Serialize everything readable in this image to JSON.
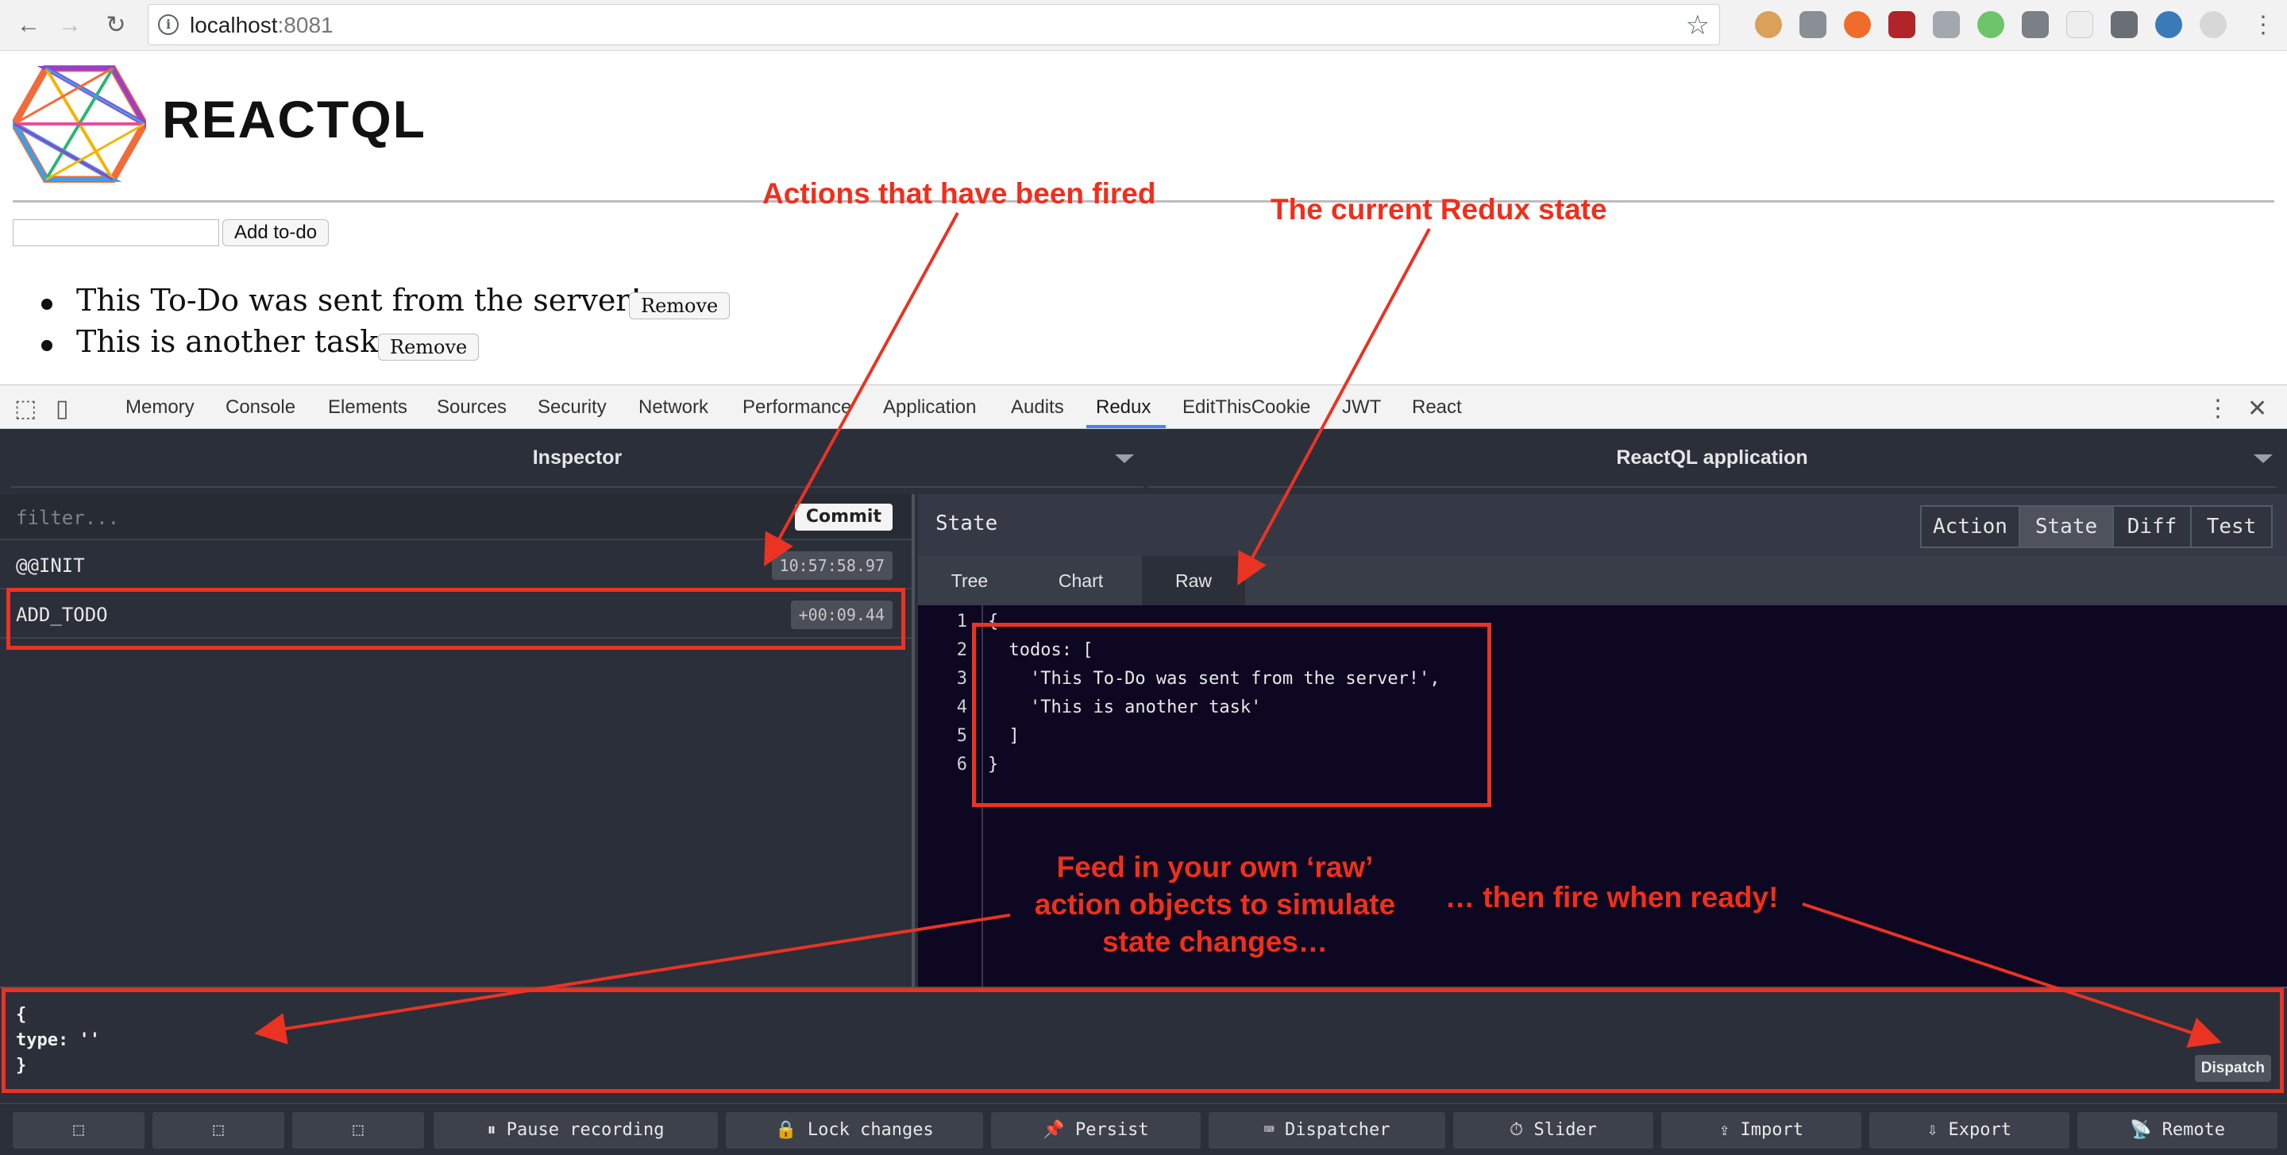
{
  "browser": {
    "url_host": "localhost",
    "url_port": ":8081"
  },
  "page": {
    "brand": "REACTQL",
    "add_button": "Add to-do",
    "todos": [
      {
        "text": "This To-Do was sent from the server!",
        "remove_label": "Remove"
      },
      {
        "text": "This is another task",
        "remove_label": "Remove"
      }
    ]
  },
  "devtools": {
    "tabs": [
      "Memory",
      "Console",
      "Elements",
      "Sources",
      "Security",
      "Network",
      "Performance",
      "Application",
      "Audits",
      "Redux",
      "EditThisCookie",
      "JWT",
      "React"
    ],
    "active_tab": "Redux"
  },
  "redux": {
    "left_monitor": "Inspector",
    "right_monitor": "ReactQL application",
    "filter_placeholder": "filter...",
    "commit_label": "Commit",
    "actions": [
      {
        "name": "@@INIT",
        "time": "10:57:58.97"
      },
      {
        "name": "ADD_TODO",
        "time": "+00:09.44"
      }
    ],
    "state_title": "State",
    "segments": [
      "Action",
      "State",
      "Diff",
      "Test"
    ],
    "active_segment": "State",
    "subtabs": [
      "Tree",
      "Chart",
      "Raw"
    ],
    "active_subtab": "Raw",
    "code_lines": [
      {
        "n": "1",
        "text": "{"
      },
      {
        "n": "2",
        "text": "  todos: ["
      },
      {
        "n": "3",
        "text": "    'This To-Do was sent from the server!',"
      },
      {
        "n": "4",
        "text": "    'This is another task'"
      },
      {
        "n": "5",
        "text": "  ]"
      },
      {
        "n": "6",
        "text": "}"
      }
    ],
    "dispatch_code": "{\ntype: ''\n}",
    "dispatch_label": "Dispatch",
    "bottom_buttons": [
      "Pause recording",
      "Lock changes",
      "Persist",
      "Dispatcher",
      "Slider",
      "Import",
      "Export",
      "Remote"
    ]
  },
  "annotations": {
    "actions_fired": "Actions that have been fired",
    "current_state": "The current Redux state",
    "feed_line1": "Feed in your own ‘raw’",
    "feed_line2": "action objects to simulate",
    "feed_line3": "state changes…",
    "fire_ready": "… then fire when ready!",
    "color": "#ef2f1c"
  }
}
